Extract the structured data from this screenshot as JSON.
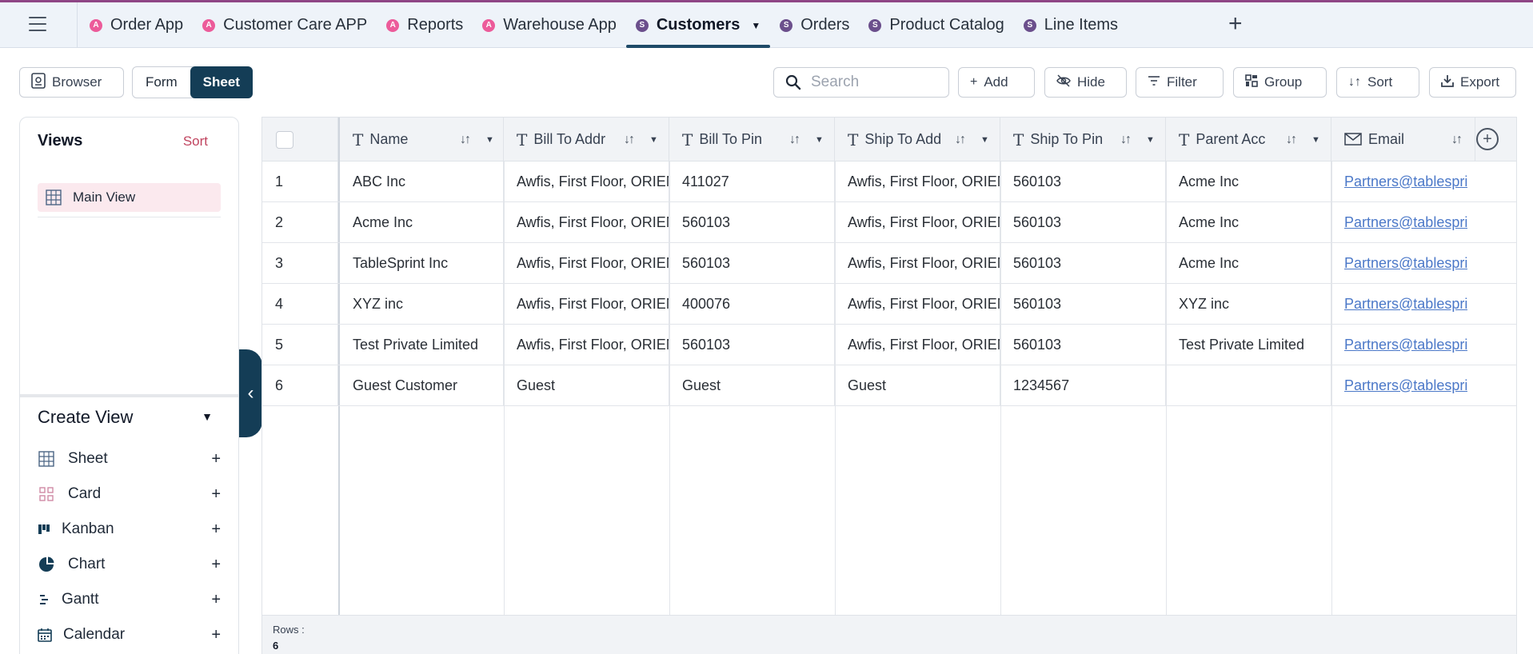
{
  "accent": "#143d56",
  "tabs": [
    {
      "label": "Order App",
      "badge": "A"
    },
    {
      "label": "Customer Care APP",
      "badge": "A"
    },
    {
      "label": "Reports",
      "badge": "A"
    },
    {
      "label": "Warehouse App",
      "badge": "A"
    },
    {
      "label": "Customers",
      "badge": "S",
      "active": true
    },
    {
      "label": "Orders",
      "badge": "S"
    },
    {
      "label": "Product Catalog",
      "badge": "S"
    },
    {
      "label": "Line Items",
      "badge": "S"
    }
  ],
  "toolbar": {
    "browser_label": "Browser",
    "form_label": "Form",
    "sheet_label": "Sheet",
    "search_placeholder": "Search",
    "add_label": "Add",
    "hide_label": "Hide",
    "filter_label": "Filter",
    "group_label": "Group",
    "sort_label": "Sort",
    "export_label": "Export"
  },
  "sidebar": {
    "views_title": "Views",
    "sort_label": "Sort",
    "main_view": "Main View",
    "create_view_title": "Create View",
    "create_items": [
      "Sheet",
      "Card",
      "Kanban",
      "Chart",
      "Gantt",
      "Calendar"
    ]
  },
  "grid": {
    "columns": [
      "Name",
      "Bill To Addr",
      "Bill To Pin",
      "Ship To Addr",
      "Ship To Pin",
      "Parent Acc",
      "Email"
    ],
    "rows": [
      {
        "n": "1",
        "name": "ABC Inc",
        "bill_addr": "Awfis, First Floor, ORIENT",
        "bill_pin": "411027",
        "ship_addr": "Awfis, First Floor, ORIENT",
        "ship_pin": "560103",
        "parent": "Acme Inc",
        "email": "Partners@tablesprint.com"
      },
      {
        "n": "2",
        "name": "Acme Inc",
        "bill_addr": "Awfis, First Floor, ORIENT",
        "bill_pin": "560103",
        "ship_addr": "Awfis, First Floor, ORIENT",
        "ship_pin": "560103",
        "parent": "Acme Inc",
        "email": "Partners@tablesprint.com"
      },
      {
        "n": "3",
        "name": "TableSprint Inc",
        "bill_addr": "Awfis, First Floor, ORIENT",
        "bill_pin": "560103",
        "ship_addr": "Awfis, First Floor, ORIENT",
        "ship_pin": "560103",
        "parent": "Acme Inc",
        "email": "Partners@tablesprint.com"
      },
      {
        "n": "4",
        "name": "XYZ inc",
        "bill_addr": "Awfis, First Floor, ORIENT",
        "bill_pin": "400076",
        "ship_addr": "Awfis, First Floor, ORIENT",
        "ship_pin": "560103",
        "parent": "XYZ inc",
        "email": "Partners@tablesprint.com"
      },
      {
        "n": "5",
        "name": "Test Private Limited",
        "bill_addr": "Awfis, First Floor, ORIENT",
        "bill_pin": "560103",
        "ship_addr": "Awfis, First Floor, ORIENT",
        "ship_pin": "560103",
        "parent": "Test Private Limited",
        "email": "Partners@tablesprint.com"
      },
      {
        "n": "6",
        "name": "Guest Customer",
        "bill_addr": "Guest",
        "bill_pin": "Guest",
        "ship_addr": "Guest",
        "ship_pin": "1234567",
        "parent": "",
        "email": "Partners@tablesprint.com"
      }
    ],
    "rows_label": "Rows :",
    "rows_count": "6"
  }
}
